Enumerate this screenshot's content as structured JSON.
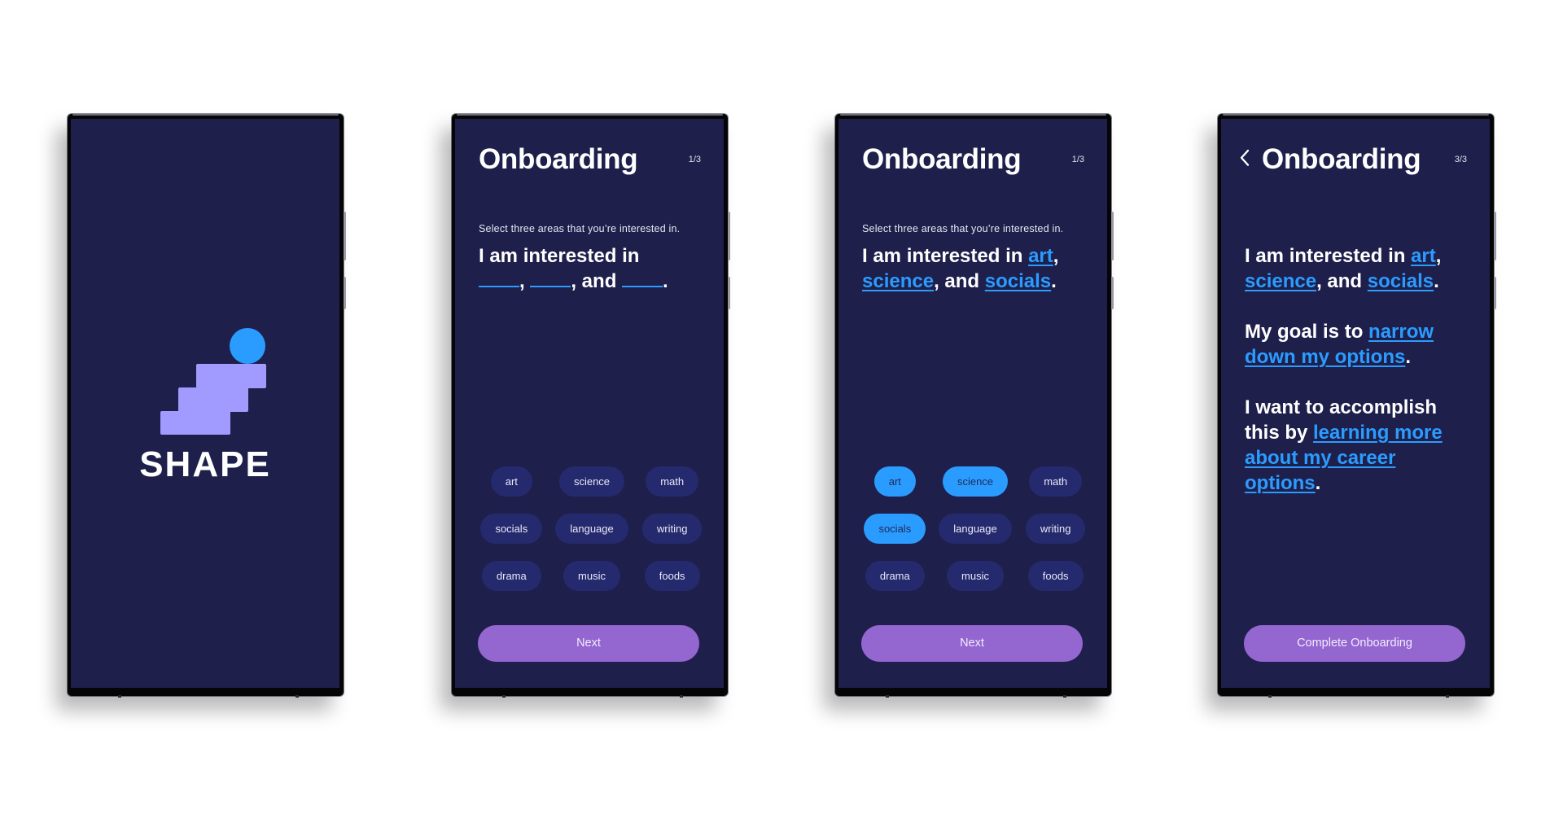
{
  "colors": {
    "screen_bg": "#1e1f4b",
    "chip_bg": "#252a6e",
    "chip_selected_bg": "#2b9cff",
    "accent_blue": "#2b9cff",
    "button_purple": "#9466d0",
    "logo_steps": "#a19bff"
  },
  "splash": {
    "brand": "SHAPE",
    "logo_icon": "stairs-with-ball-icon"
  },
  "screen2": {
    "title": "Onboarding",
    "step": "1/3",
    "subtitle": "Select three areas that you’re interested in.",
    "statement": {
      "prefix": "I am interested in",
      "sep1": ",",
      "sep2": ", and",
      "end": "."
    },
    "chips": [
      {
        "label": "art",
        "selected": false
      },
      {
        "label": "science",
        "selected": false
      },
      {
        "label": "math",
        "selected": false
      },
      {
        "label": "socials",
        "selected": false
      },
      {
        "label": "language",
        "selected": false
      },
      {
        "label": "writing",
        "selected": false
      },
      {
        "label": "drama",
        "selected": false
      },
      {
        "label": "music",
        "selected": false
      },
      {
        "label": "foods",
        "selected": false
      }
    ],
    "button": "Next"
  },
  "screen3": {
    "title": "Onboarding",
    "step": "1/3",
    "subtitle": "Select three areas that you’re interested in.",
    "statement": {
      "prefix": "I am interested in",
      "choice1": "art",
      "sep1": ",",
      "choice2": "science",
      "sep2": ", and",
      "choice3": "socials",
      "end": "."
    },
    "chips": [
      {
        "label": "art",
        "selected": true
      },
      {
        "label": "science",
        "selected": true
      },
      {
        "label": "math",
        "selected": false
      },
      {
        "label": "socials",
        "selected": true
      },
      {
        "label": "language",
        "selected": false
      },
      {
        "label": "writing",
        "selected": false
      },
      {
        "label": "drama",
        "selected": false
      },
      {
        "label": "music",
        "selected": false
      },
      {
        "label": "foods",
        "selected": false
      }
    ],
    "button": "Next"
  },
  "screen4": {
    "back_icon": "chevron-left-icon",
    "title": "Onboarding",
    "step": "3/3",
    "interest": {
      "prefix": "I am interested in",
      "choice1": "art",
      "sep1": ",",
      "choice2": "science",
      "sep2": ", and",
      "choice3": "socials",
      "end": "."
    },
    "goal": {
      "prefix": "My goal is to",
      "choice": "narrow down my options",
      "end": "."
    },
    "method": {
      "prefix": "I want to accomplish this by",
      "choice": "learning more about my career options",
      "end": "."
    },
    "button": "Complete Onboarding"
  }
}
